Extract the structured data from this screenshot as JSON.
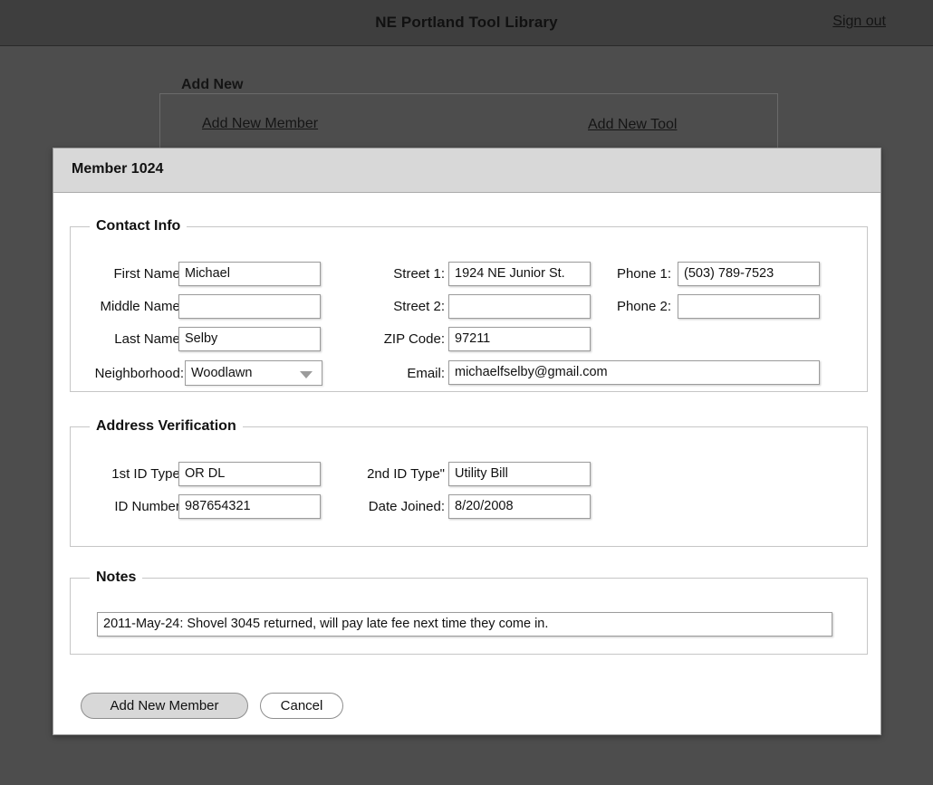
{
  "header": {
    "title": "NE Portland Tool Library",
    "sign_out": "Sign out"
  },
  "background": {
    "fieldset_legend": "Add New",
    "links": [
      {
        "label": "Add New Member"
      },
      {
        "label": "Add New Tool"
      }
    ]
  },
  "dialog": {
    "title": "Member 1024",
    "sections": {
      "contact": {
        "legend": "Contact Info",
        "fields": [
          {
            "label": "First Name:",
            "value": "Michael"
          },
          {
            "label": "Middle Name:",
            "value": ""
          },
          {
            "label": "Last Name:",
            "value": "Selby"
          },
          {
            "label": "Neighborhood:",
            "value": "Woodlawn"
          },
          {
            "label": "Street 1:",
            "value": "1924 NE Junior St."
          },
          {
            "label": "Street 2:",
            "value": ""
          },
          {
            "label": "ZIP Code:",
            "value": "97211"
          },
          {
            "label": "Email:",
            "value": "michaelfselby@gmail.com"
          },
          {
            "label": "Phone 1:",
            "value": "(503) 789-7523"
          },
          {
            "label": "Phone 2:",
            "value": ""
          }
        ]
      },
      "address_verification": {
        "legend": "Address Verification",
        "fields": [
          {
            "label": "1st ID Type:",
            "value": "OR DL"
          },
          {
            "label": "ID Number:",
            "value": "987654321"
          },
          {
            "label": "2nd ID Type\"",
            "value": "Utility Bill"
          },
          {
            "label": "Date Joined:",
            "value": "8/20/2008"
          }
        ]
      },
      "notes": {
        "legend": "Notes",
        "value": "2011-May-24: Shovel 3045 returned, will pay late fee next time they come in."
      }
    },
    "buttons": {
      "submit": "Add New Member",
      "cancel": "Cancel"
    }
  },
  "icons": {
    "dropdown": "chevron-down-icon"
  },
  "colors": {
    "page_background": "#4d4d4d",
    "header_background": "#3e3e3e",
    "dialog_background": "#ffffff",
    "dialog_titlebar": "#d8d8d8",
    "primary_button": "#d8d8d8"
  }
}
